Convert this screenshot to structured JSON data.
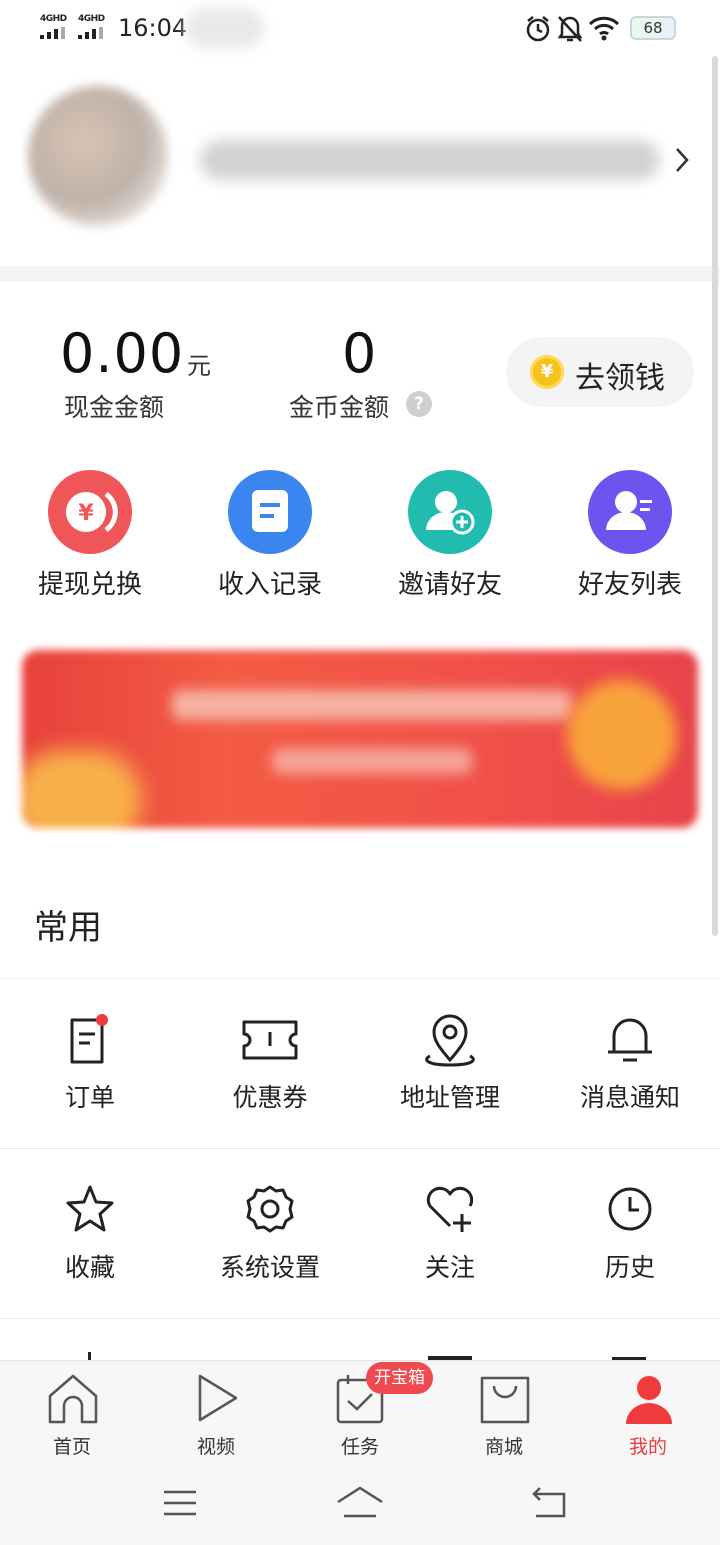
{
  "status_bar": {
    "signal1_label": "4GHD",
    "signal2_label": "4GHD",
    "time": "16:04",
    "battery": "68",
    "icons": [
      "alarm-icon",
      "mute-icon",
      "wifi-icon"
    ]
  },
  "wallet": {
    "cash_amount": "0.00",
    "cash_unit": "元",
    "cash_label": "现金金额",
    "coin_amount": "0",
    "coin_label": "金币金额",
    "help_icon": "?",
    "get_money_label": "去领钱",
    "coin_icon_symbol": "¥"
  },
  "quick_actions": [
    {
      "label": "提现兑换",
      "icon": "yuan-coins-icon",
      "color": "#f0555a"
    },
    {
      "label": "收入记录",
      "icon": "document-icon",
      "color": "#3a85ee"
    },
    {
      "label": "邀请好友",
      "icon": "add-person-icon",
      "color": "#22bbb0"
    },
    {
      "label": "好友列表",
      "icon": "person-list-icon",
      "color": "#6b55ee"
    }
  ],
  "common": {
    "title": "常用",
    "items": [
      {
        "label": "订单",
        "icon": "order-icon"
      },
      {
        "label": "优惠券",
        "icon": "coupon-icon"
      },
      {
        "label": "地址管理",
        "icon": "location-icon"
      },
      {
        "label": "消息通知",
        "icon": "bell-icon"
      },
      {
        "label": "收藏",
        "icon": "star-icon"
      },
      {
        "label": "系统设置",
        "icon": "gear-icon"
      },
      {
        "label": "关注",
        "icon": "heart-plus-icon"
      },
      {
        "label": "历史",
        "icon": "clock-icon"
      }
    ]
  },
  "bottom_nav": {
    "tabs": [
      {
        "label": "首页",
        "icon": "home-icon"
      },
      {
        "label": "视频",
        "icon": "play-icon"
      },
      {
        "label": "任务",
        "icon": "task-icon"
      },
      {
        "label": "商城",
        "icon": "bag-icon"
      },
      {
        "label": "我的",
        "icon": "person-icon"
      }
    ],
    "active": "我的",
    "badge": "开宝箱"
  },
  "colors": {
    "accent_red": "#ef3b3b",
    "coin_gold": "#f7c21b"
  }
}
